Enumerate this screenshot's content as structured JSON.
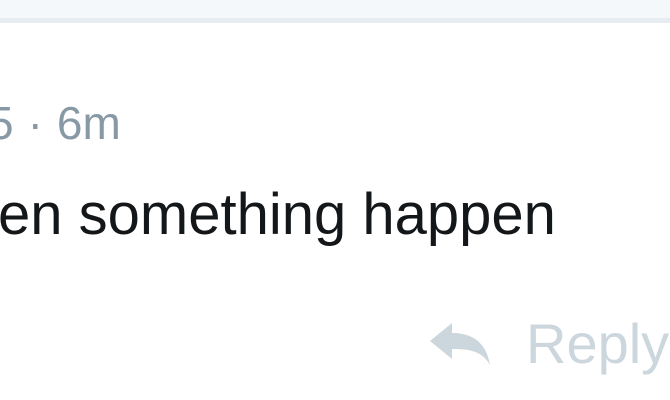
{
  "comment": {
    "meta_left": "5",
    "meta_separator": "·",
    "timestamp": "6m",
    "text": "en something happen",
    "reply_label": "Reply",
    "reply_icon": "reply-arrow-icon"
  },
  "colors": {
    "meta": "#8899a6",
    "text": "#14171a",
    "reply": "#ccd6dd",
    "divider": "#e6ecf0"
  }
}
